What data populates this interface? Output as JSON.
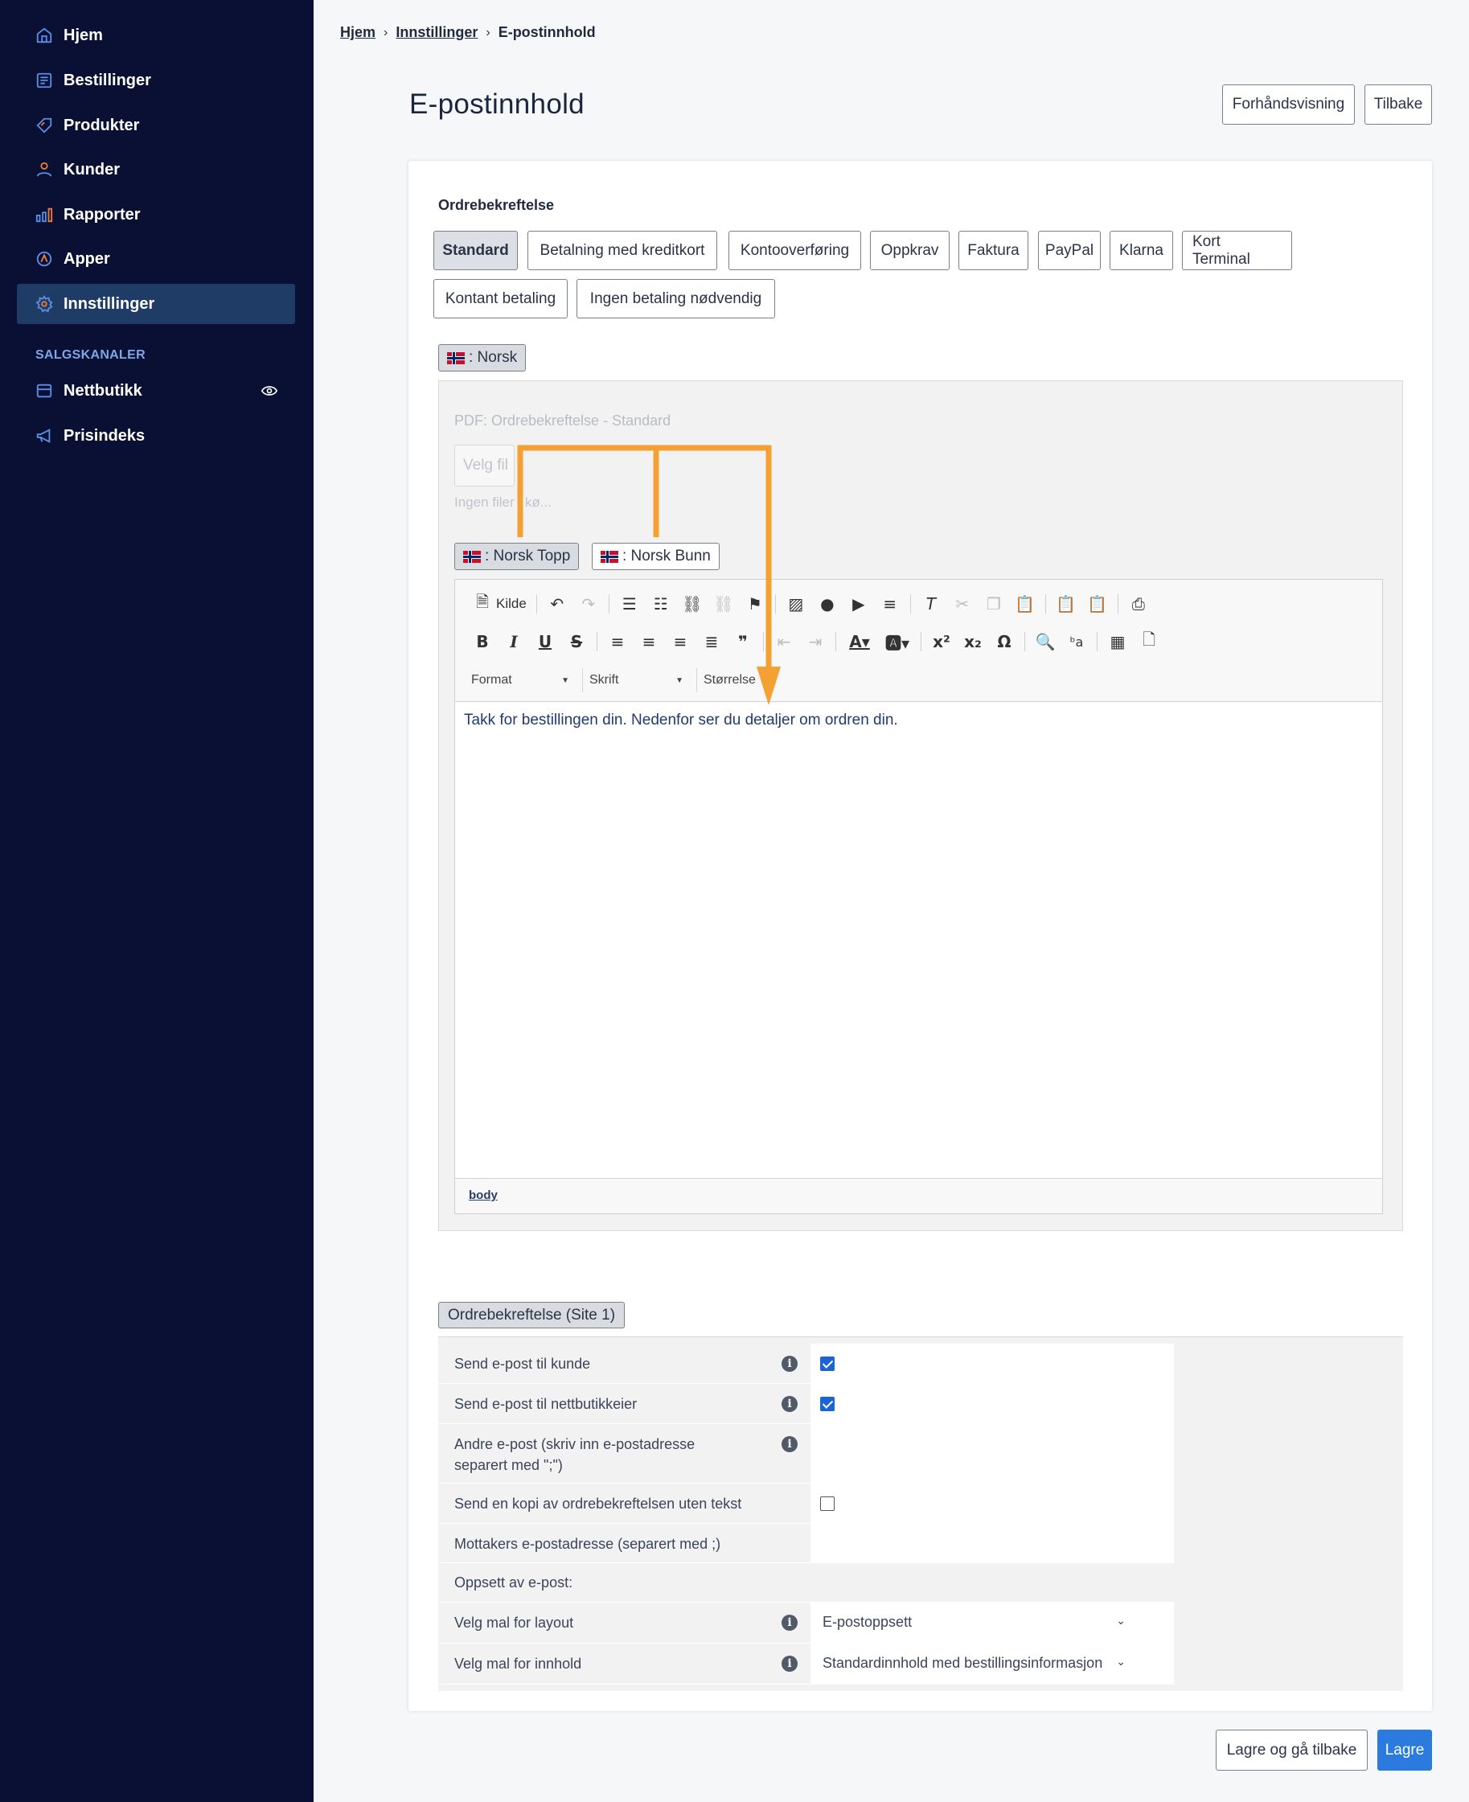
{
  "sidebar": {
    "items": [
      {
        "label": "Hjem",
        "icon": "home-icon"
      },
      {
        "label": "Bestillinger",
        "icon": "orders-icon"
      },
      {
        "label": "Produkter",
        "icon": "tag-icon"
      },
      {
        "label": "Kunder",
        "icon": "user-icon"
      },
      {
        "label": "Rapporter",
        "icon": "bar-chart-icon"
      },
      {
        "label": "Apper",
        "icon": "apps-icon"
      },
      {
        "label": "Innstillinger",
        "icon": "gear-icon"
      }
    ],
    "section_title": "SALGSKANALER",
    "channels": [
      {
        "label": "Nettbutikk",
        "icon": "store-icon"
      },
      {
        "label": "Prisindeks",
        "icon": "megaphone-icon"
      }
    ]
  },
  "breadcrumb": {
    "home": "Hjem",
    "settings": "Innstillinger",
    "current": "E-postinnhold"
  },
  "page": {
    "title": "E-postinnhold",
    "preview_button": "Forhåndsvisning",
    "back_button": "Tilbake"
  },
  "section": {
    "title": "Ordrebekreftelse"
  },
  "payment_tabs": [
    "Standard",
    "Betalning med kreditkort",
    "Kontooverføring",
    "Oppkrav",
    "Faktura",
    "PayPal",
    "Klarna",
    "Kort Terminal",
    "Kontant betaling",
    "Ingen betaling nødvendig"
  ],
  "language_tab": ": Norsk",
  "pdf": {
    "label": "PDF: Ordrebekreftelse - Standard",
    "file_button": "Velg fil",
    "file_note": "Ingen filer i kø..."
  },
  "position_tabs": [
    ": Norsk Topp",
    ": Norsk Bunn"
  ],
  "editor": {
    "source_label": "Kilde",
    "format_label": "Format",
    "font_label": "Skrift",
    "size_label": "Størrelse",
    "content": "Takk for bestillingen din. Nedenfor ser du detaljer om ordren din.",
    "path": "body"
  },
  "settings": {
    "tab": "Ordrebekreftelse (Site 1)",
    "rows": [
      {
        "label": "Send e-post til kunde",
        "checked": true
      },
      {
        "label": "Send e-post til nettbutikkeier",
        "checked": true
      },
      {
        "label": "Andre e-post (skriv inn e-postadresse",
        "label2": "separert med \";\")"
      },
      {
        "label": "Send en kopi av ordrebekreftelsen uten tekst",
        "checked": false
      },
      {
        "label": "Mottakers e-postadresse (separert med ;)"
      },
      {
        "label": "Oppsett av e-post:"
      },
      {
        "label": "Velg mal for layout",
        "value": "E-postoppsett"
      },
      {
        "label": "Velg mal for innhold",
        "value": "Standardinnhold med bestillingsinformasjon"
      }
    ]
  },
  "footer": {
    "save_back": "Lagre og gå tilbake",
    "save": "Lagre"
  },
  "colors": {
    "sidebar_bg": "#0a1033",
    "active_nav": "#1f3c66",
    "primary": "#2b7bde",
    "annotation": "#f5a033"
  }
}
